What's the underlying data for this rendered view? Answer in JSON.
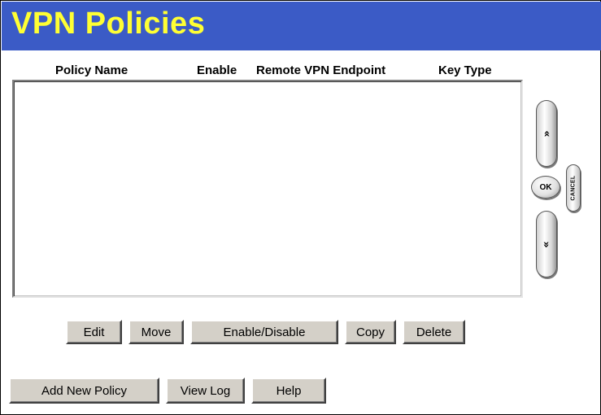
{
  "header": {
    "title": "VPN Policies"
  },
  "table": {
    "columns": [
      "Policy Name",
      "Enable",
      "Remote VPN Endpoint",
      "Key Type"
    ],
    "rows": []
  },
  "nav": {
    "scroll_up_glyph": "«",
    "ok_label": "OK",
    "cancel_label": "CANCEL",
    "scroll_down_glyph": "«"
  },
  "actions": {
    "edit": "Edit",
    "move": "Move",
    "enable_disable": "Enable/Disable",
    "copy": "Copy",
    "delete": "Delete"
  },
  "footer": {
    "add_new_policy": "Add New Policy",
    "view_log": "View Log",
    "help": "Help"
  },
  "colors": {
    "title_bar": "#3b5bc6",
    "title_text": "#ffff33",
    "button_face": "#d4d0c8"
  }
}
